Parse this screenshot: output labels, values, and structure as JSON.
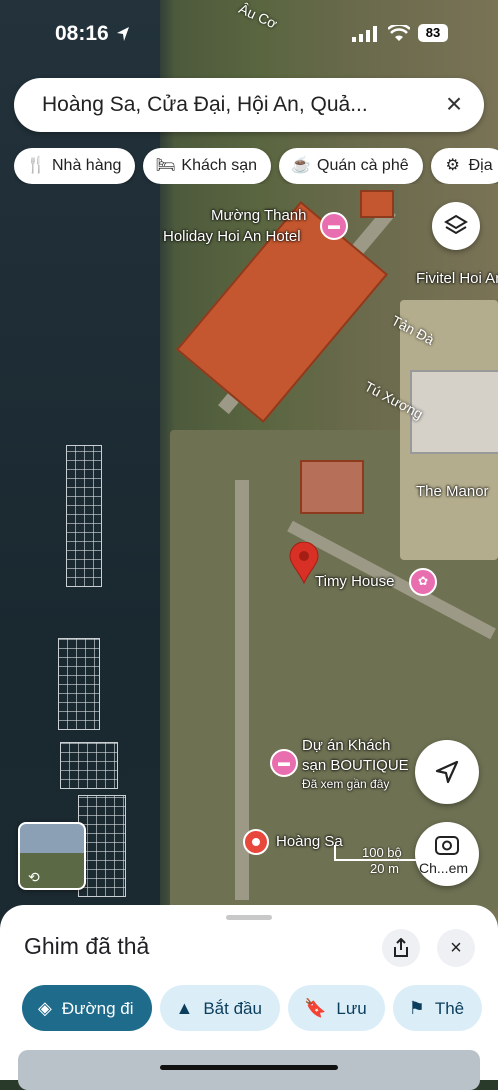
{
  "status": {
    "time": "08:16",
    "battery": "83"
  },
  "search": {
    "query": "Hoàng Sa, Cửa Đại, Hội An, Quả..."
  },
  "chips": [
    {
      "icon": "fork-knife-icon",
      "label": "Nhà hàng"
    },
    {
      "icon": "bed-icon",
      "label": "Khách sạn"
    },
    {
      "icon": "coffee-cup-icon",
      "label": "Quán cà phê"
    },
    {
      "icon": "attraction-icon",
      "label": "Địa"
    }
  ],
  "map": {
    "places": [
      {
        "name": "Mường Thanh",
        "name2": "Holiday Hoi An Hotel"
      },
      {
        "name": "Fivitel Hoi An H"
      },
      {
        "name": "The Manor"
      },
      {
        "name": "Timy House"
      },
      {
        "name": "Dự án Khách",
        "name2": "sạn BOUTIQUE",
        "note": "Đã xem gần đây"
      },
      {
        "name": "Hoàng Sa"
      }
    ],
    "roads": [
      "Âu Cơ",
      "Tản Đà",
      "Tú Xương"
    ],
    "scale": {
      "top": "100 bộ",
      "bottom": "20 m"
    },
    "compass_label": "Ch...em"
  },
  "sheet": {
    "title": "Ghim đã thả",
    "actions": [
      {
        "icon": "directions-icon",
        "label": "Đường đi"
      },
      {
        "icon": "navigation-arrow-icon",
        "label": "Bắt đầu"
      },
      {
        "icon": "bookmark-icon",
        "label": "Lưu"
      },
      {
        "icon": "flag-icon",
        "label": "Thê"
      }
    ]
  },
  "colors": {
    "accent": "#1e6b8c",
    "chip_action": "#dbeef8",
    "poi": "#e96eb0",
    "pin": "#d93025"
  }
}
